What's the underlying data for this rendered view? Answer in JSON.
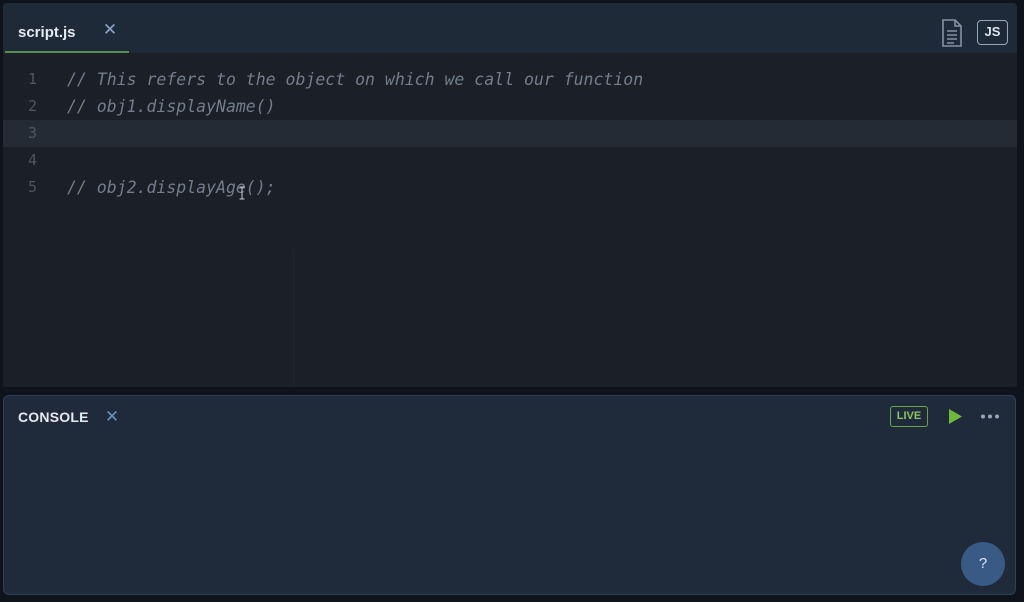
{
  "editor": {
    "tab": {
      "label": "script.js",
      "close_glyph": "✕"
    },
    "language_badge": "JS",
    "file_icon": "document-icon",
    "active_line": 3,
    "lines": [
      {
        "number": "1",
        "text": "// This refers to the object on which we call our function"
      },
      {
        "number": "2",
        "text": "// obj1.displayName()"
      },
      {
        "number": "3",
        "text": ""
      },
      {
        "number": "4",
        "text": ""
      },
      {
        "number": "5",
        "text": "// obj2.displayAge();"
      }
    ]
  },
  "console": {
    "title": "CONSOLE",
    "close_glyph": "✕",
    "live_label": "LIVE",
    "run_icon": "play-icon",
    "more_icon": "ellipsis-icon",
    "help_label": "?"
  },
  "colors": {
    "accent_green": "#5b8c4f",
    "live_green": "#8dc262",
    "run_green": "#6fb83e",
    "help_blue": "#3a5a86",
    "comment_gray": "#737d8c"
  }
}
